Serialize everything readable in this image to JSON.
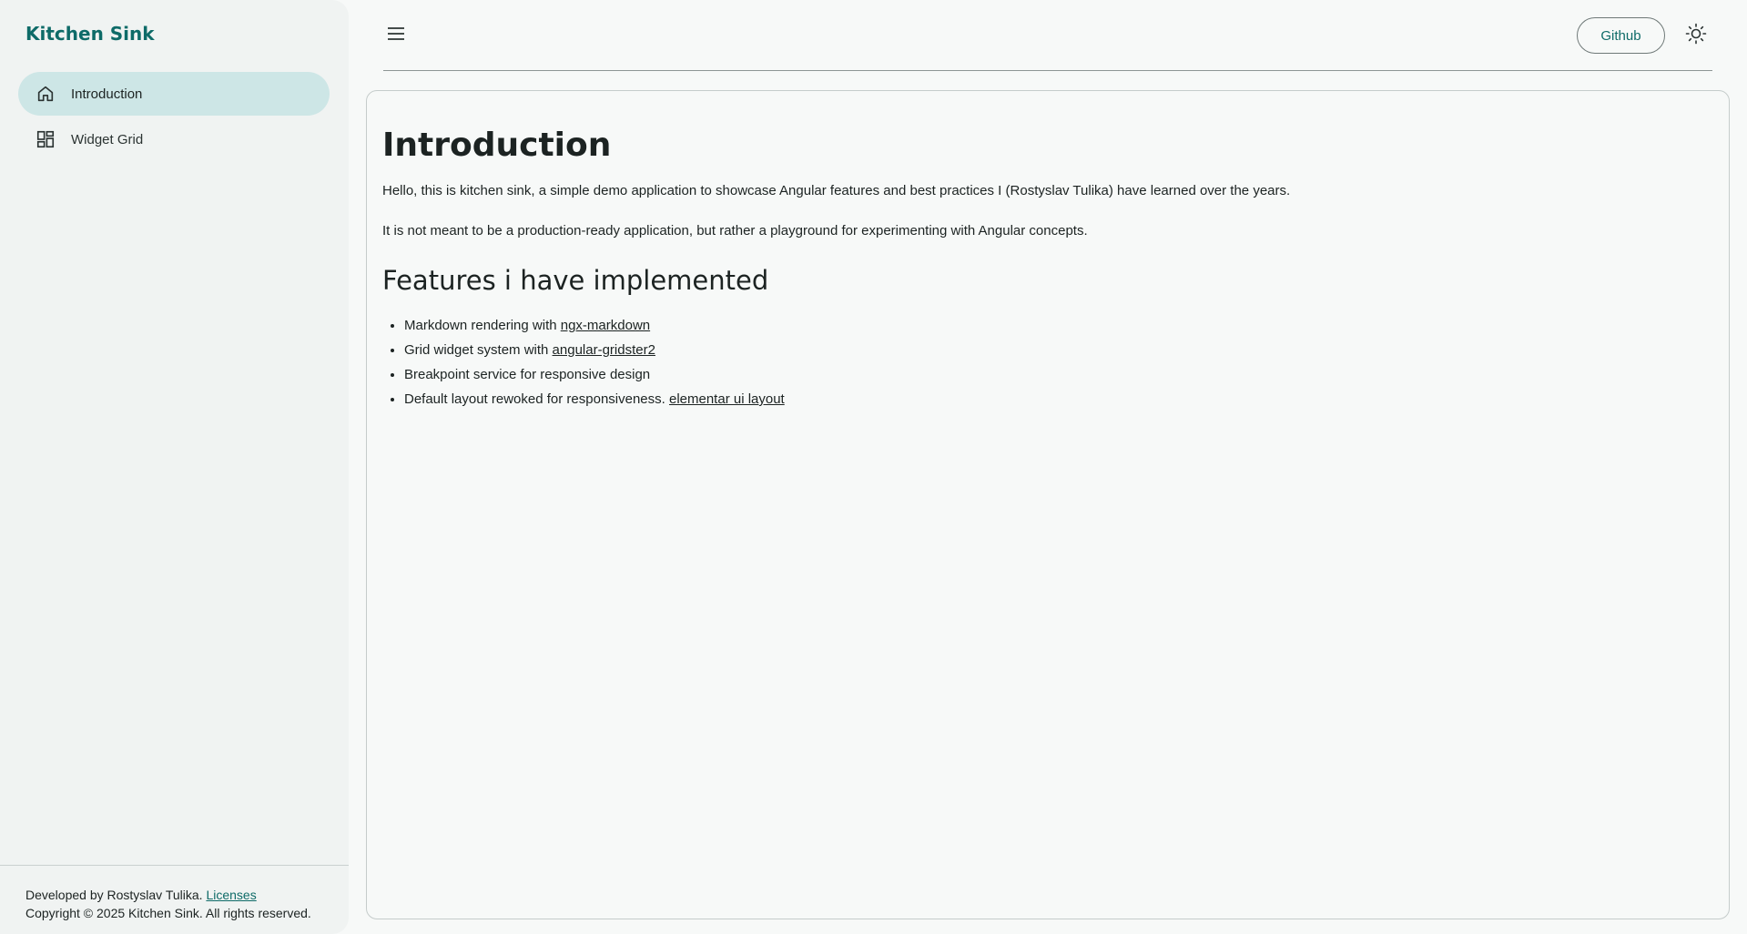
{
  "sidebar": {
    "brand": "Kitchen Sink",
    "items": [
      {
        "label": "Introduction",
        "icon": "home-icon",
        "active": true
      },
      {
        "label": "Widget Grid",
        "icon": "grid-icon",
        "active": false
      }
    ],
    "footer": {
      "developed_by": "Developed by Rostyslav Tulika.",
      "licenses_link": "Licenses",
      "copyright": "Copyright © 2025 Kitchen Sink. All rights reserved."
    }
  },
  "topbar": {
    "menu_icon": "hamburger-menu-icon",
    "github_label": "Github",
    "theme_icon": "sun-icon"
  },
  "content": {
    "title": "Introduction",
    "paragraph1": "Hello, this is kitchen sink, a simple demo application to showcase Angular features and best practices I (Rostyslav Tulika) have learned over the years.",
    "paragraph2": "It is not meant to be a production-ready application, but rather a playground for experimenting with Angular concepts.",
    "features_heading": "Features i have implemented",
    "features": [
      {
        "text": "Markdown rendering with ",
        "link": "ngx-markdown"
      },
      {
        "text": "Grid widget system with ",
        "link": "angular-gridster2"
      },
      {
        "text": "Breakpoint service for responsive design",
        "link": ""
      },
      {
        "text": "Default layout rewoked for responsiveness. ",
        "link": "elementar ui layout"
      }
    ]
  },
  "colors": {
    "accent": "#0e6b68",
    "active_nav_bg": "#cde6e6",
    "background": "#f7f9f8",
    "sidebar_bg": "#f0f3f2"
  }
}
